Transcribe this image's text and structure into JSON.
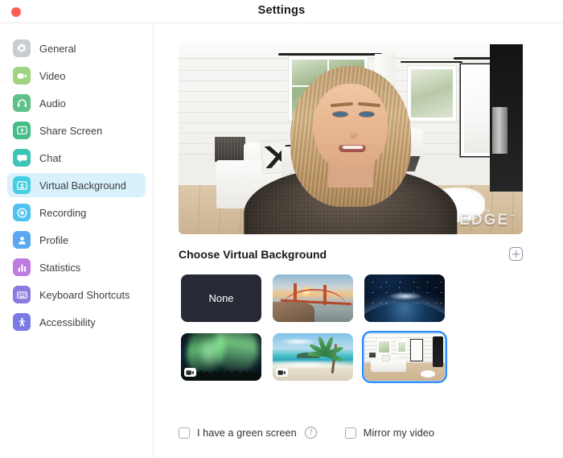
{
  "window": {
    "title": "Settings",
    "close_button": "close"
  },
  "sidebar": {
    "items": [
      {
        "label": "General",
        "icon": "gear-icon",
        "color": "#c9ccd1",
        "selected": false
      },
      {
        "label": "Video",
        "icon": "video-icon",
        "color": "#9ed47f",
        "selected": false
      },
      {
        "label": "Audio",
        "icon": "headset-icon",
        "color": "#5ec08a",
        "selected": false
      },
      {
        "label": "Share Screen",
        "icon": "share-icon",
        "color": "#45bd86",
        "selected": false
      },
      {
        "label": "Chat",
        "icon": "chat-icon",
        "color": "#3cc4b7",
        "selected": false
      },
      {
        "label": "Virtual Background",
        "icon": "person-card-icon",
        "color": "#44cde4",
        "selected": true
      },
      {
        "label": "Recording",
        "icon": "record-icon",
        "color": "#4ec3f0",
        "selected": false
      },
      {
        "label": "Profile",
        "icon": "profile-icon",
        "color": "#5aa8f0",
        "selected": false
      },
      {
        "label": "Statistics",
        "icon": "bar-chart-icon",
        "color": "#b munic",
        "selected": false
      },
      {
        "label": "Keyboard Shortcuts",
        "icon": "keyboard-icon",
        "color": "#8b7ae0",
        "selected": false
      },
      {
        "label": "Accessibility",
        "icon": "accessibility-icon",
        "color": "#7b7ae6",
        "selected": false
      }
    ],
    "icon_colors": [
      "#c9ccd1",
      "#9ed47f",
      "#5ec08a",
      "#45bd86",
      "#3cc4b7",
      "#44cde4",
      "#4ec3f0",
      "#5aa8f0",
      "#bf7ce0",
      "#8b7ae0",
      "#7b7ae6"
    ],
    "selected_background": "#d9f1fb"
  },
  "preview": {
    "watermark": "EDGE",
    "watermark_tm": "™",
    "watermark_small": "yourEDGE"
  },
  "main": {
    "section_title": "Choose Virtual Background",
    "add_button": "add-background"
  },
  "backgrounds": [
    {
      "name": "None",
      "label": "None",
      "type": "none",
      "selected": false,
      "has_video_badge": false
    },
    {
      "name": "Golden Gate Bridge",
      "label": "",
      "type": "bridge",
      "selected": false,
      "has_video_badge": false
    },
    {
      "name": "Earth from Space",
      "label": "",
      "type": "earth",
      "selected": false,
      "has_video_badge": false
    },
    {
      "name": "Aurora Borealis",
      "label": "",
      "type": "aurora",
      "selected": false,
      "has_video_badge": true
    },
    {
      "name": "Tropical Beach",
      "label": "",
      "type": "beach",
      "selected": false,
      "has_video_badge": true
    },
    {
      "name": "Living Room",
      "label": "",
      "type": "living",
      "selected": true,
      "has_video_badge": false
    }
  ],
  "footer": {
    "green_screen_label": "I have a green screen",
    "green_screen_checked": false,
    "help_icon": "?",
    "mirror_label": "Mirror my video",
    "mirror_checked": false
  },
  "colors": {
    "accent": "#2d8cff",
    "selected_nav": "#d9f1fb",
    "close_dot": "#fb5f57",
    "text": "#2f3237"
  }
}
